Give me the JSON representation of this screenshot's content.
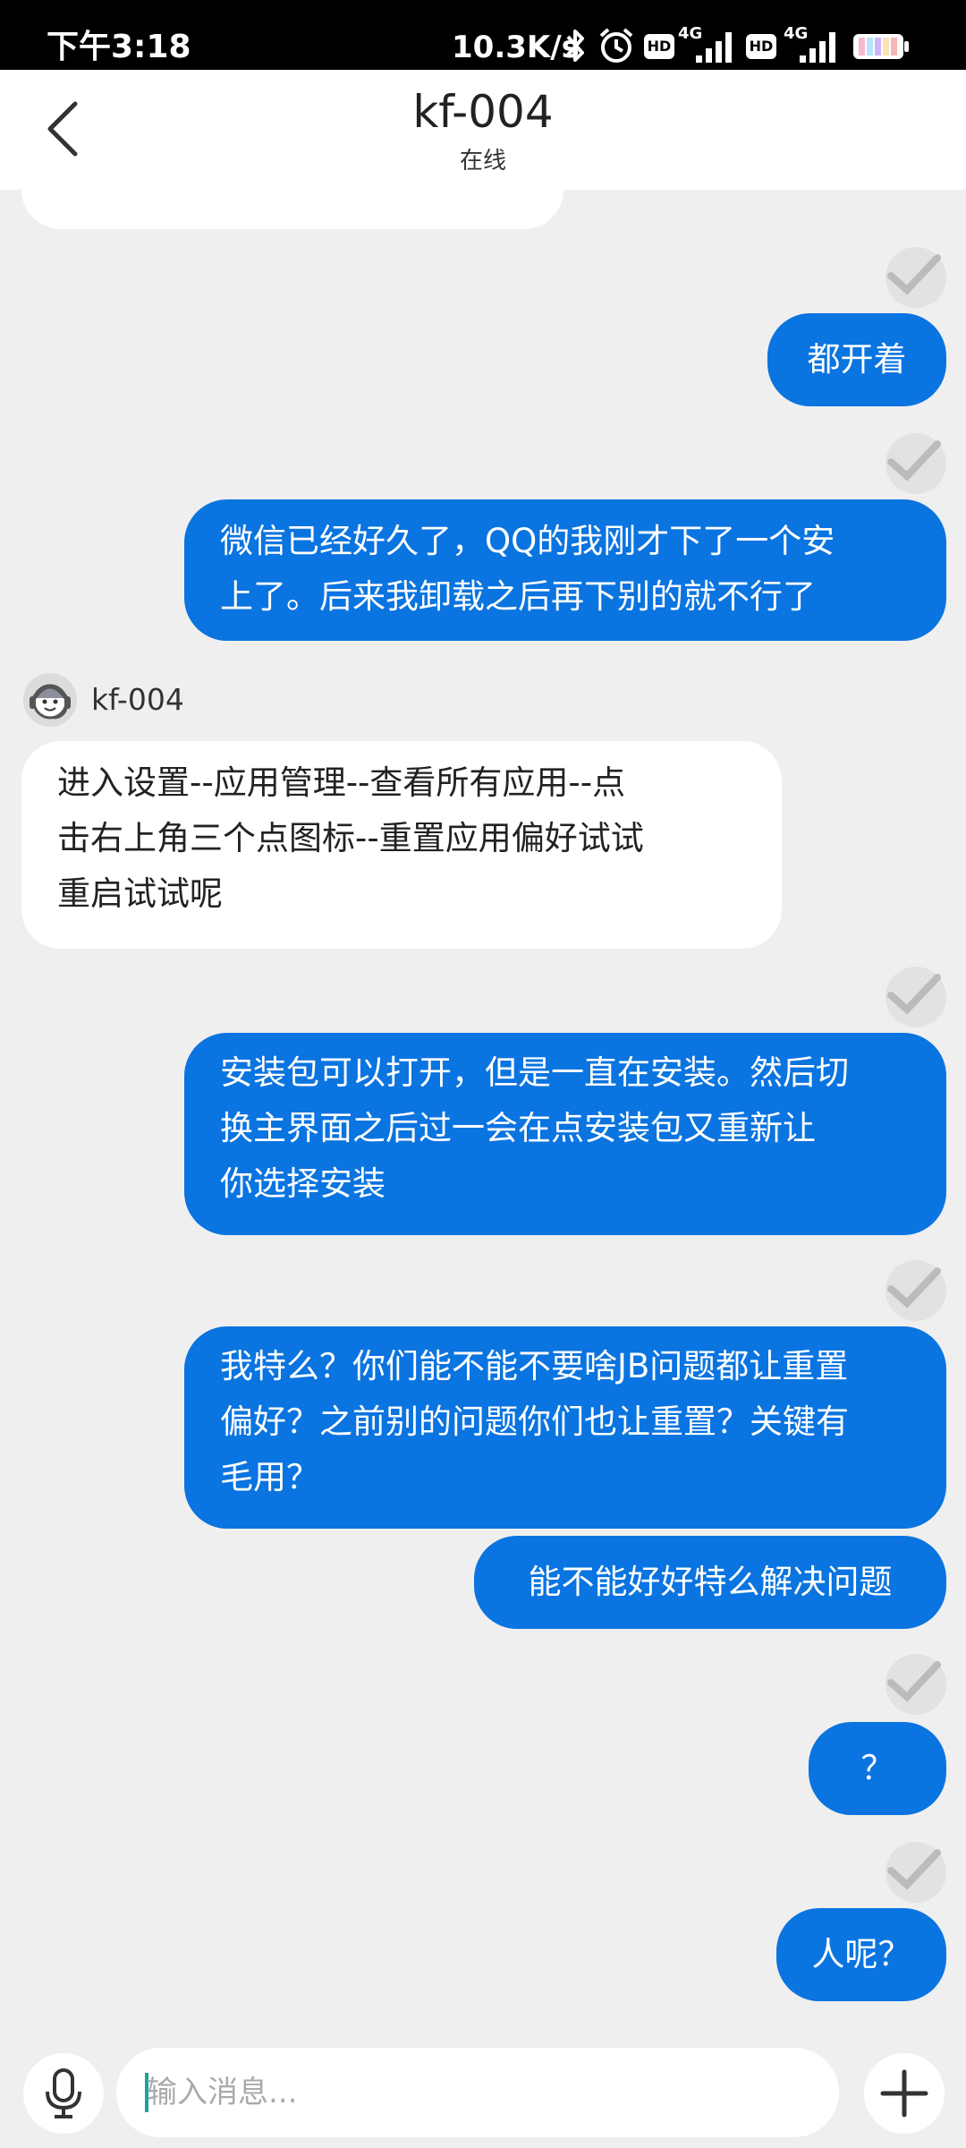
{
  "status_bar": {
    "time": "下午3:18",
    "net_speed": "10.3K/s",
    "sim1_badge": "HD",
    "sim1_network": "4G",
    "sim2_badge": "HD",
    "sim2_network": "4G",
    "icons": [
      "bluetooth-icon",
      "alarm-icon",
      "signal-icon",
      "battery-icon"
    ]
  },
  "header": {
    "back_icon": "chevron-left-icon",
    "title": "kf-004",
    "status": "在线"
  },
  "agent": {
    "name": "kf-004",
    "avatar_icon": "customer-service-avatar-icon"
  },
  "messages": [
    {
      "from": "user",
      "text": "都开着",
      "read_icon": "read-receipt-icon"
    },
    {
      "from": "user",
      "lines": [
        "微信已经好久了，QQ的我刚才下了一个安",
        "上了。后来我卸载之后再下别的就不行了"
      ],
      "read_icon": "read-receipt-icon"
    },
    {
      "from": "agent",
      "lines": [
        "进入设置--应用管理--查看所有应用--点",
        "击右上角三个点图标--重置应用偏好试试",
        "重启试试呢"
      ]
    },
    {
      "from": "user",
      "lines": [
        "安装包可以打开，但是一直在安装。然后切",
        "换主界面之后过一会在点安装包又重新让",
        "你选择安装"
      ],
      "read_icon": "read-receipt-icon"
    },
    {
      "from": "user",
      "lines": [
        "我特么？你们能不能不要啥JB问题都让重置",
        "偏好？之前别的问题你们也让重置？关键有",
        "毛用？"
      ],
      "read_icon": "read-receipt-icon"
    },
    {
      "from": "user",
      "text": "能不能好好特么解决问题"
    },
    {
      "from": "user",
      "text": "？",
      "read_icon": "read-receipt-icon"
    },
    {
      "from": "user",
      "text": "人呢？",
      "read_icon": "read-receipt-icon"
    }
  ],
  "input_bar": {
    "placeholder": "输入消息...",
    "mic_icon": "microphone-icon",
    "emoji_icon": "emoji-icon",
    "plus_icon": "plus-icon"
  },
  "colors": {
    "outgoing_bubble": "#0a74e0",
    "incoming_bubble": "#ffffff",
    "background": "#efefef",
    "status_bar": "#000000"
  }
}
